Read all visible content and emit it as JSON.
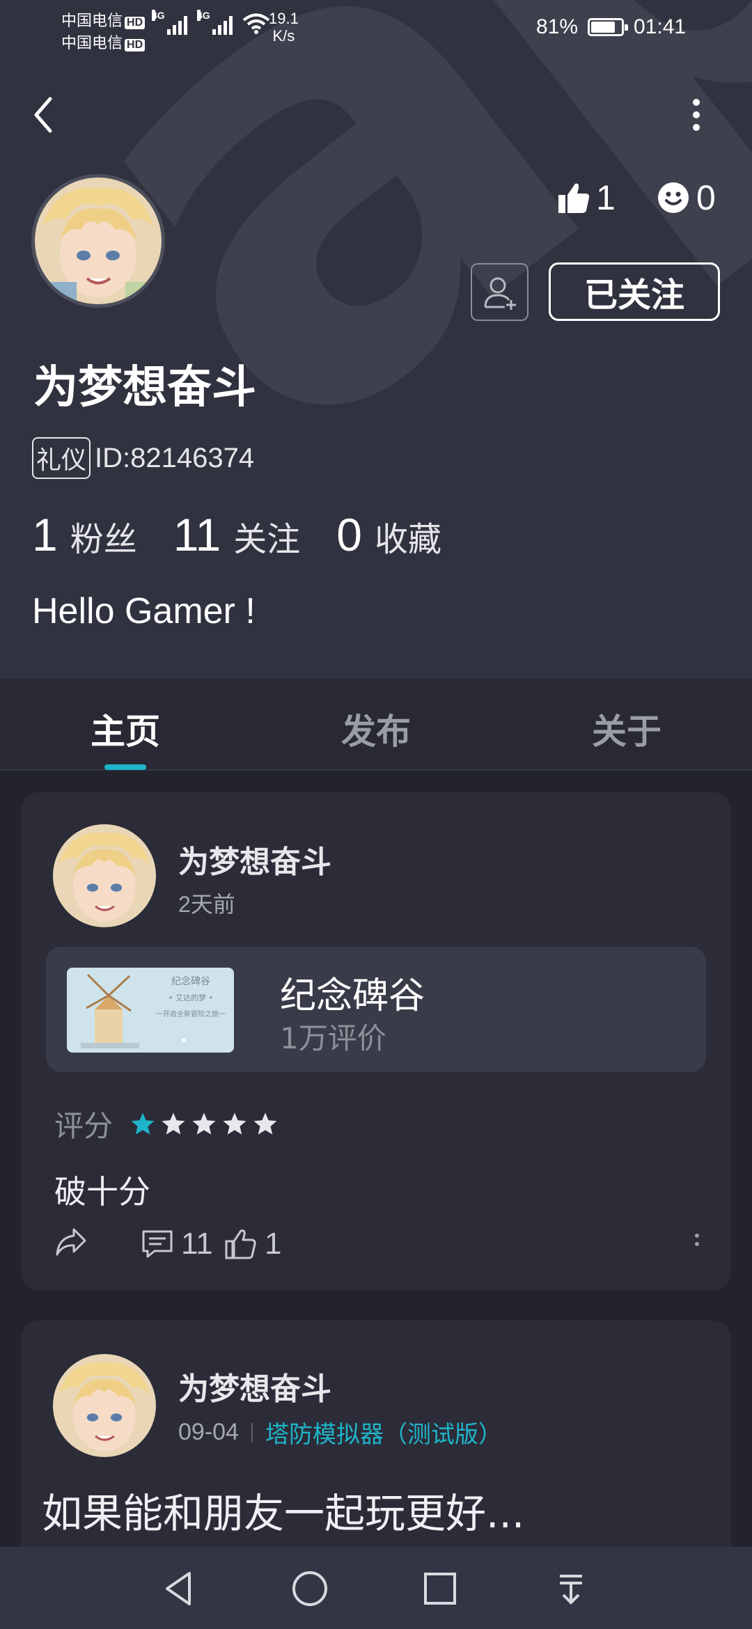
{
  "status_bar": {
    "carrier_1": "中国电信",
    "carrier_2": "中国电信",
    "hd_badge": "HD",
    "network_type": "4G",
    "net_speed_value": "19.1",
    "net_speed_unit": "K/s",
    "battery_percent": "81%",
    "battery_level": 0.81,
    "time": "01:41"
  },
  "profile": {
    "username": "为梦想奋斗",
    "badge": "礼仪",
    "id_text": "ID:82146374",
    "likes": "1",
    "smiles": "0",
    "follow_button": "已关注",
    "bio": "Hello Gamer !",
    "fans_count": "1",
    "fans_label": "粉丝",
    "following_count": "11",
    "following_label": "关注",
    "favorites_count": "0",
    "favorites_label": "收藏",
    "watermark": "apTa"
  },
  "tabs": [
    {
      "label": "主页",
      "active": true
    },
    {
      "label": "发布",
      "active": false
    },
    {
      "label": "关于",
      "active": false
    }
  ],
  "post1": {
    "author": "为梦想奋斗",
    "time": "2天前",
    "game_title": "纪念碑谷",
    "game_reviews": "1万评价",
    "thumb_title": "纪念碑谷",
    "thumb_sub1": "• 艾达的梦 •",
    "thumb_sub2": "一开启全新冒险之旅一",
    "rating_label": "评分",
    "rating": 1,
    "rating_max": 5,
    "review_text": "破十分",
    "comments": "11",
    "likes": "1"
  },
  "post2": {
    "author": "为梦想奋斗",
    "date": "09-04",
    "game": "塔防模拟器（测试版）",
    "text": "如果能和朋友一起玩更好..."
  },
  "colors": {
    "accent": "#1fb4c9",
    "header_bg": "#30323f",
    "page_bg": "#22232d",
    "card_bg": "#2b2c38",
    "star_inactive": "#e8e8ec"
  },
  "icons": {
    "back": "chevron-left-icon",
    "more": "more-vertical-icon",
    "like": "thumbs-up-icon",
    "smile": "smile-icon",
    "add_friend": "user-plus-icon",
    "share": "share-icon",
    "comment": "comment-icon",
    "nav_back": "triangle-back-icon",
    "nav_home": "circle-home-icon",
    "nav_recent": "square-recent-icon",
    "nav_down": "pull-down-icon"
  }
}
